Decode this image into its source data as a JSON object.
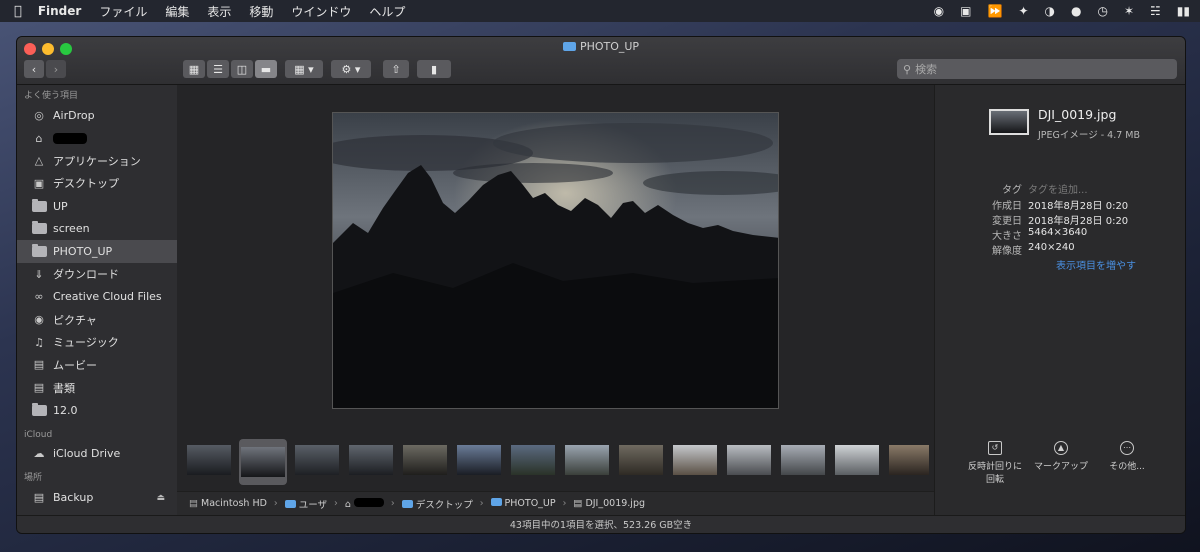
{
  "menubar": {
    "app": "Finder",
    "items": [
      "ファイル",
      "編集",
      "表示",
      "移動",
      "ウインドウ",
      "ヘルプ"
    ]
  },
  "window": {
    "title": "PHOTO_UP"
  },
  "search": {
    "placeholder": "検索"
  },
  "sidebar": {
    "favorites_label": "よく使う項目",
    "favorites": [
      {
        "label": "AirDrop",
        "icon": "airdrop-icon"
      },
      {
        "label": "",
        "icon": "home-icon",
        "redacted": true
      },
      {
        "label": "アプリケーション",
        "icon": "applications-icon"
      },
      {
        "label": "デスクトップ",
        "icon": "desktop-icon"
      },
      {
        "label": "UP",
        "icon": "folder-icon"
      },
      {
        "label": "screen",
        "icon": "folder-icon"
      },
      {
        "label": "PHOTO_UP",
        "icon": "folder-icon",
        "selected": true
      },
      {
        "label": "ダウンロード",
        "icon": "download-icon"
      },
      {
        "label": "Creative Cloud Files",
        "icon": "creative-cloud-icon"
      },
      {
        "label": "ピクチャ",
        "icon": "camera-icon"
      },
      {
        "label": "ミュージック",
        "icon": "music-icon"
      },
      {
        "label": "ムービー",
        "icon": "film-icon"
      },
      {
        "label": "書類",
        "icon": "document-icon"
      },
      {
        "label": "12.0",
        "icon": "folder-icon"
      }
    ],
    "icloud_label": "iCloud",
    "icloud_drive": "iCloud Drive",
    "locations_label": "場所",
    "backup": "Backup"
  },
  "inspector": {
    "filename": "DJI_0019.jpg",
    "kind": "JPEGイメージ - 4.7 MB",
    "tags_label": "タグ",
    "tags_placeholder": "タグを追加...",
    "created_label": "作成日",
    "created": "2018年8月28日 0:20",
    "modified_label": "変更日",
    "modified": "2018年8月28日 0:20",
    "size_label": "大きさ",
    "size": "5464×3640",
    "resolution_label": "解像度",
    "resolution": "240×240",
    "show_more": "表示項目を増やす",
    "actions": {
      "rotate_line1": "反時計回りに",
      "rotate_line2": "回転",
      "markup": "マークアップ",
      "more": "その他..."
    }
  },
  "pathbar": {
    "items": [
      "Macintosh HD",
      "ユーザ",
      "",
      "デスクトップ",
      "PHOTO_UP",
      "DJI_0019.jpg"
    ]
  },
  "status": "43項目中の1項目を選択、523.26 GB空き",
  "colors": {
    "accent": "#5fa5e8",
    "window_bg": "#2a2a2c",
    "sidebar_selected": "#4a4a4e"
  }
}
